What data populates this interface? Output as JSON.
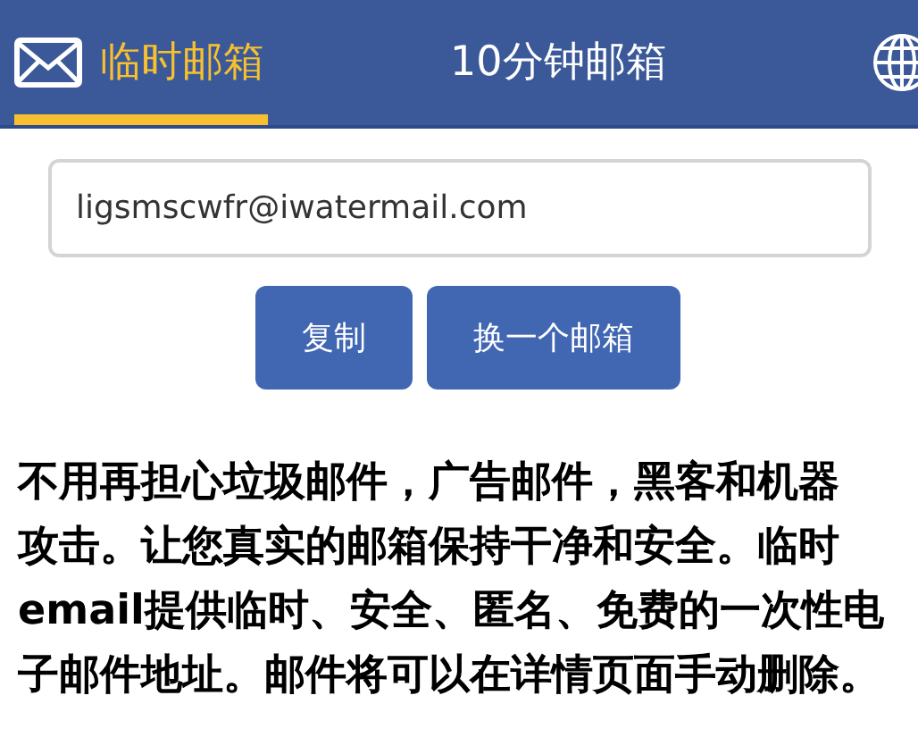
{
  "tabs": [
    {
      "label": "临时邮箱",
      "selected": true,
      "kind": "icon"
    },
    {
      "label": "10分钟邮箱",
      "selected": false,
      "kind": "plain"
    }
  ],
  "email_field": {
    "value": "ligsmscwfr@iwatermail.com"
  },
  "buttons": [
    "复制",
    "换一个邮箱"
  ],
  "description_lines": [
    "不用再担心垃圾邮件，广告邮件，黑客和机器",
    "攻击。让您真实的邮箱保持干净和安全。临时",
    "email提供临时、安全、匿名、免费的一次性电",
    "子邮件地址。邮件将可以在详情页面手动删除。"
  ]
}
